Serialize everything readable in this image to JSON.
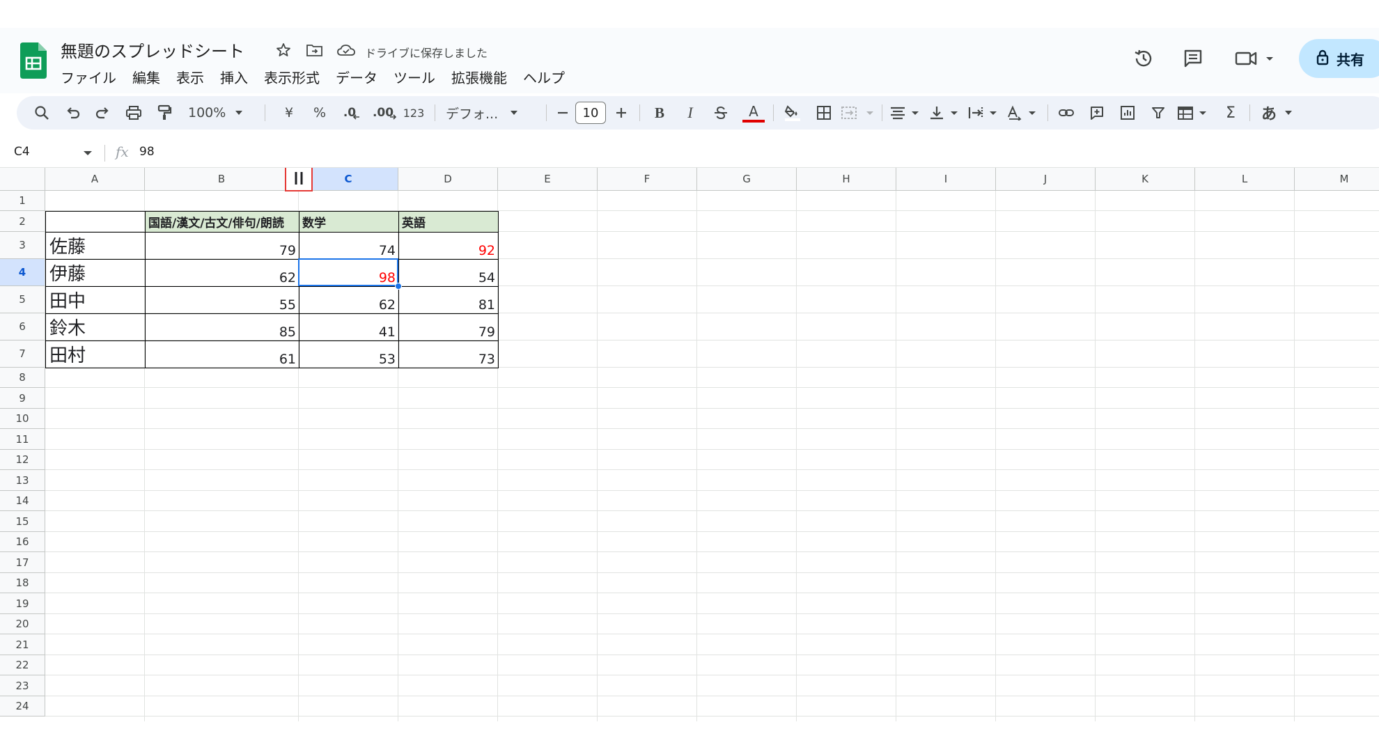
{
  "app": {
    "doc_title": "無題のスプレッドシート",
    "save_status": "ドライブに保存しました",
    "share_label": "共有"
  },
  "menu": [
    "ファイル",
    "編集",
    "表示",
    "挿入",
    "表示形式",
    "データ",
    "ツール",
    "拡張機能",
    "ヘルプ"
  ],
  "toolbar": {
    "zoom": "100%",
    "currency": "¥",
    "percent": "%",
    "decimal_decrease": ".0",
    "decimal_increase": ".00",
    "number_format": "123",
    "font": "デフォ...",
    "font_size": "10",
    "input_mode": "あ",
    "text_color": "#e00000"
  },
  "formula_bar": {
    "name_box": "C4",
    "fx": "fx",
    "value": "98"
  },
  "columns": [
    "A",
    "B",
    "C",
    "D",
    "E",
    "F",
    "G",
    "H",
    "I",
    "J",
    "K",
    "L",
    "M"
  ],
  "rows": [
    "1",
    "2",
    "3",
    "4",
    "5",
    "6",
    "7",
    "8",
    "9",
    "10",
    "11",
    "12",
    "13",
    "14",
    "15",
    "16",
    "17",
    "18",
    "19",
    "20",
    "21",
    "22",
    "23",
    "24"
  ],
  "selected_cell": "C4",
  "table": {
    "headers": [
      "国語/漢文/古文/俳句/朗読",
      "数学",
      "英語"
    ],
    "rows": [
      {
        "name": "佐藤",
        "values": [
          "79",
          "74",
          "92"
        ]
      },
      {
        "name": "伊藤",
        "values": [
          "62",
          "98",
          "54"
        ]
      },
      {
        "name": "田中",
        "values": [
          "55",
          "62",
          "81"
        ]
      },
      {
        "name": "鈴木",
        "values": [
          "85",
          "41",
          "79"
        ]
      },
      {
        "name": "田村",
        "values": [
          "61",
          "53",
          "73"
        ]
      }
    ],
    "highlight_color": "#ff0000",
    "header_fill": "#d9ead3"
  }
}
